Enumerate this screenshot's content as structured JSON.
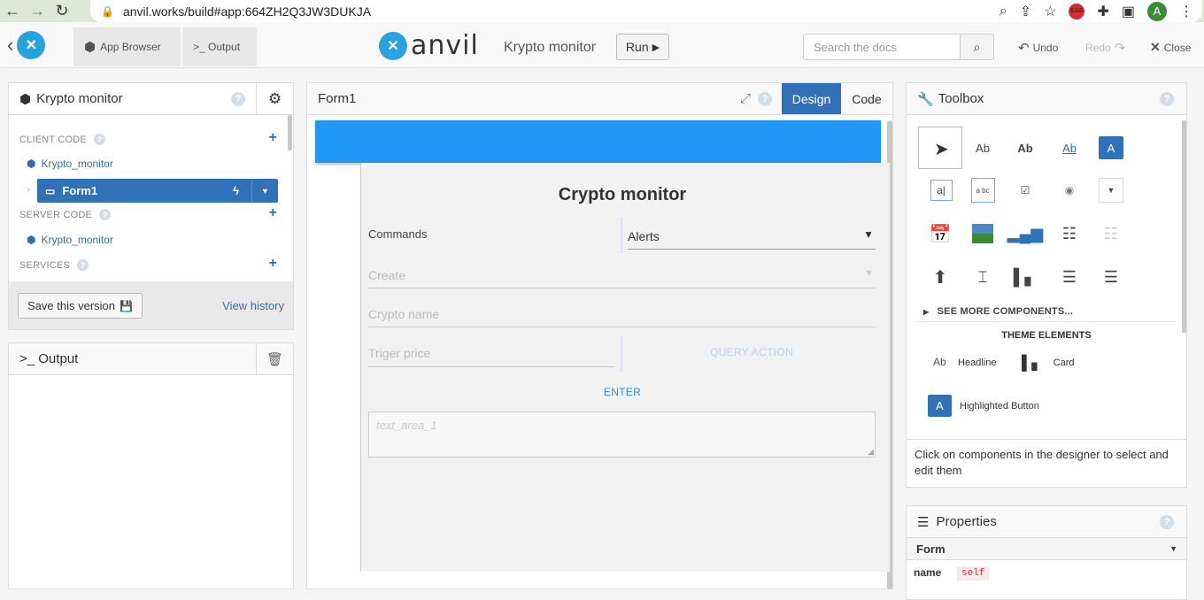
{
  "browser": {
    "url": "anvil.works/build#app:664ZH2Q3JW3DUKJA",
    "avatar": "A",
    "ext_badge": "EAB"
  },
  "topbar": {
    "app_browser": "App Browser",
    "output": ">_ Output",
    "brand": "anvil",
    "app_name": "Krypto monitor",
    "run": "Run",
    "search_placeholder": "Search the docs",
    "undo": "Undo",
    "redo": "Redo",
    "close": "Close"
  },
  "left_panel": {
    "title": "Krypto monitor",
    "client_code": "CLIENT CODE",
    "client_module": "Krypto_monitor",
    "form1": "Form1",
    "server_code": "SERVER CODE",
    "server_module": "Krypto_monitor",
    "services": "SERVICES",
    "save_version": "Save this version",
    "view_history": "View history"
  },
  "output_panel": {
    "title": ">_ Output"
  },
  "designer": {
    "title": "Form1",
    "design_tab": "Design",
    "code_tab": "Code",
    "form_heading": "Crypto monitor",
    "commands_label": "Commands",
    "alerts_value": "Alerts",
    "create_placeholder": "Create",
    "crypto_name_placeholder": "Crypto name",
    "trigger_price_placeholder": "Triger price",
    "query_action": "QUERY ACTION",
    "enter": "ENTER",
    "textarea_placeholder": "text_area_1"
  },
  "toolbox": {
    "title": "Toolbox",
    "see_more": "SEE MORE COMPONENTS...",
    "theme_elements": "THEME ELEMENTS",
    "headline": "Headline",
    "card": "Card",
    "highlighted_button": "Highlighted Button",
    "hint": "Click on components in the designer to select and edit them",
    "label_ab": "Ab",
    "button_a": "A"
  },
  "properties": {
    "title": "Properties",
    "section": "Form",
    "name_label": "name",
    "name_value": "self"
  },
  "colors": {
    "accent_blue": "#2196f3",
    "selection_blue": "#3071b7",
    "link_blue": "#2f6eb5"
  }
}
